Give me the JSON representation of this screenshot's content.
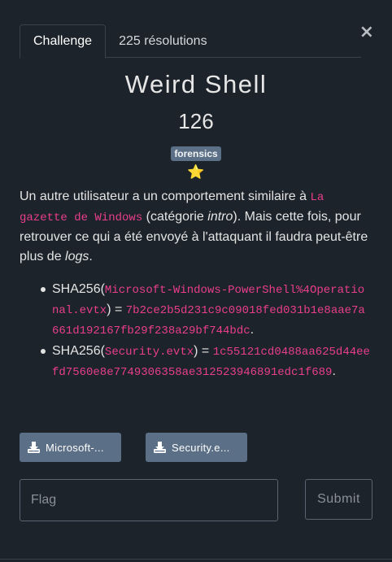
{
  "tabs": [
    {
      "label": "Challenge",
      "active": true
    },
    {
      "label": "225 résolutions",
      "active": false
    }
  ],
  "close_icon": "×",
  "challenge": {
    "name": "Weird Shell",
    "points": "126",
    "tag": "forensics",
    "star": "⭐"
  },
  "description": {
    "p1": "Un autre utilisateur a un comportement similaire à ",
    "code1": "La gazette de Windows",
    "p2": " (catégorie ",
    "em1": "intro",
    "p3": "). Mais cette fois, pour retrouver ce qui a été envoyé à l'attaquant il faudra peut-être plus de ",
    "em2": "logs",
    "p4": "."
  },
  "hashes": [
    {
      "prefix": "SHA256(",
      "file": "Microsoft-Windows-PowerShell%4Operational.evtx",
      "mid": ") = ",
      "hash": "7b2ce2b5d231c9c09018fed031b1e8aae7a661d192167fb29f238a29bf744bdc",
      "suffix": "."
    },
    {
      "prefix": "SHA256(",
      "file": "Security.evtx",
      "mid": ") = ",
      "hash": "1c55121cd0488aa625d44eefd7560e8e7749306358ae312523946891edc1f689",
      "suffix": "."
    }
  ],
  "downloads": [
    {
      "label": "Microsoft-...",
      "icon": "download-icon"
    },
    {
      "label": "Security.e...",
      "icon": "download-icon"
    }
  ],
  "flag_input": {
    "placeholder": "Flag",
    "value": ""
  },
  "submit_label": "Submit",
  "colors": {
    "background": "#1d232a",
    "tag_bg": "#5b6f86",
    "code": "#e83e8c",
    "star": "#f5c518"
  }
}
